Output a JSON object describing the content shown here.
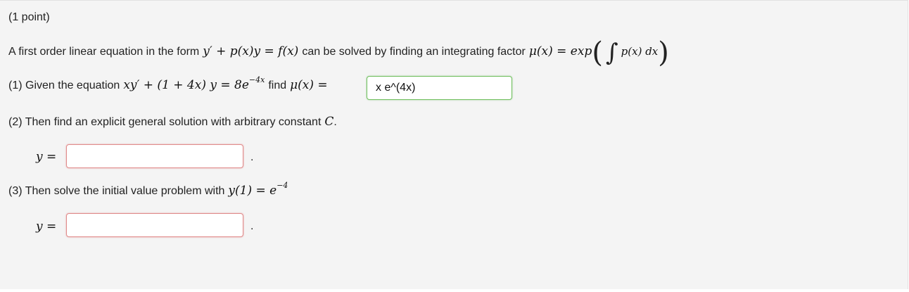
{
  "problem": {
    "points": "(1 point)",
    "intro_text": "A first order linear equation in the form",
    "intro_eq": "y′ + p(x)y = f(x)",
    "intro_mid": "can be solved by finding an integrating factor",
    "mu_lhs": "μ(x) = exp",
    "integrand": "p(x) dx"
  },
  "part1": {
    "label": "(1) Given the equation",
    "equation": "xy′ + (1 + 4x) y = 8e",
    "exponent": "−4x",
    "find_text": "find",
    "mu": "μ(x) =",
    "answer_value": "x e^(4x)",
    "answer_state": "correct"
  },
  "part2": {
    "label": "(2) Then find an explicit general solution with arbitrary constant",
    "constant": "C",
    "period": ".",
    "y_label": "y =",
    "answer_value": "",
    "answer_state": "incorrect",
    "trailing": "."
  },
  "part3": {
    "label": "(3) Then solve the initial value problem with",
    "condition": "y(1) = e",
    "exponent": "−4",
    "y_label": "y =",
    "answer_value": "",
    "answer_state": "incorrect",
    "trailing": "."
  },
  "colors": {
    "panel_bg": "#f4f4f4",
    "correct_border": "#6fbf5e",
    "incorrect_border": "#e08b8b"
  }
}
